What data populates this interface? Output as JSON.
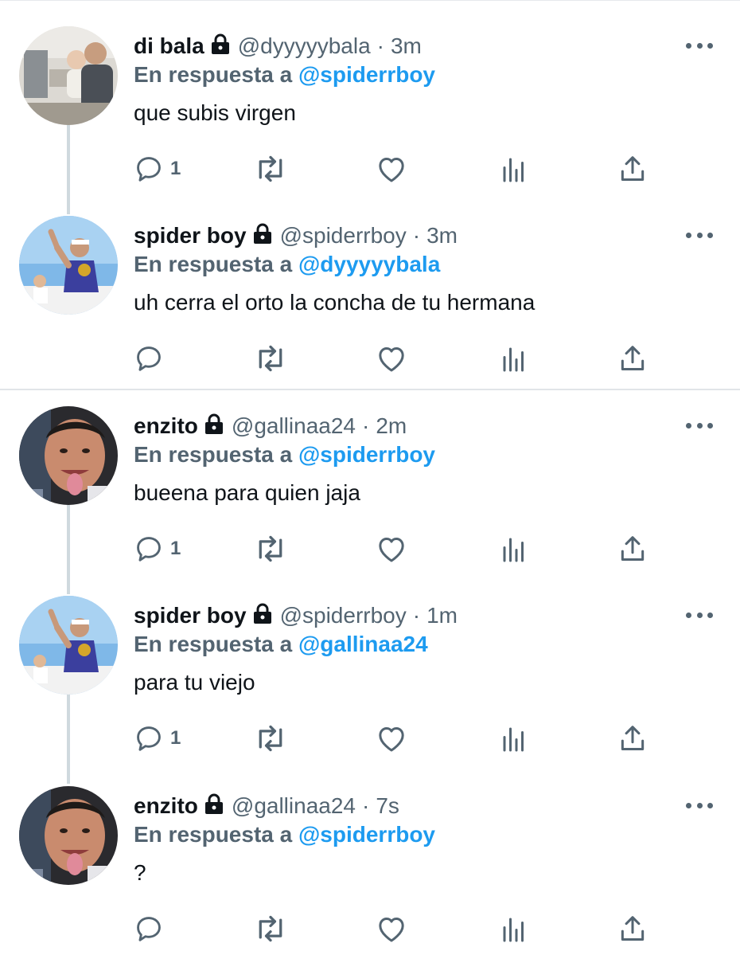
{
  "reply_prefix": "En respuesta a ",
  "colors": {
    "text": "#0f1419",
    "secondary": "#536471",
    "accent": "#1d9bf0",
    "thread_line": "#cfd9de"
  },
  "tweets": [
    {
      "name": "di bala",
      "handle": "@dyyyyybala",
      "separator": "·",
      "time": "3m",
      "reply_to": "@spiderrboy",
      "text": "que subis virgen",
      "reply_count": "1",
      "avatar": "avatar-di-bala"
    },
    {
      "name": "spider boy",
      "handle": "@spiderrboy",
      "separator": "·",
      "time": "3m",
      "reply_to": "@dyyyyybala",
      "text": "uh cerra el orto la concha de tu hermana",
      "reply_count": "",
      "avatar": "avatar-spider-boy"
    },
    {
      "name": "enzito",
      "handle": "@gallinaa24",
      "separator": "·",
      "time": "2m",
      "reply_to": "@spiderrboy",
      "text": "bueena para quien jaja",
      "reply_count": "1",
      "avatar": "avatar-enzito"
    },
    {
      "name": "spider boy",
      "handle": "@spiderrboy",
      "separator": "·",
      "time": "1m",
      "reply_to": "@gallinaa24",
      "text": "para tu viejo",
      "reply_count": "1",
      "avatar": "avatar-spider-boy"
    },
    {
      "name": "enzito",
      "handle": "@gallinaa24",
      "separator": "·",
      "time": "7s",
      "reply_to": "@spiderrboy",
      "text": "?",
      "reply_count": "",
      "avatar": "avatar-enzito"
    }
  ]
}
